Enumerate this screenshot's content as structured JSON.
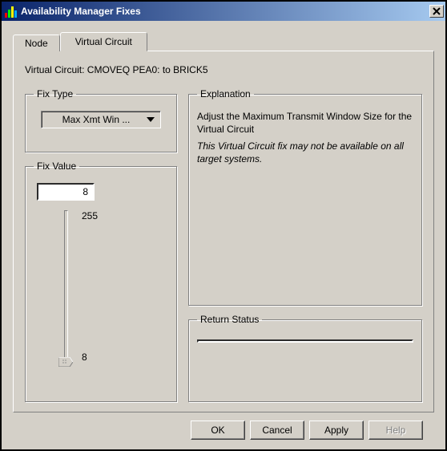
{
  "window": {
    "title": "Availability Manager Fixes"
  },
  "tabs": {
    "node": "Node",
    "virtual_circuit": "Virtual Circuit"
  },
  "vc_label": "Virtual Circuit: CMOVEQ PEA0: to BRICK5",
  "fix_type": {
    "legend": "Fix Type",
    "selected": "Max Xmt Win ..."
  },
  "fix_value": {
    "legend": "Fix Value",
    "value": "8",
    "max": "255",
    "min": "8"
  },
  "explanation": {
    "legend": "Explanation",
    "line1": "Adjust the Maximum Transmit Window Size for the Virtual Circuit",
    "line2": "This Virtual Circuit fix may not be available on all target systems."
  },
  "return_status": {
    "legend": "Return Status",
    "value": ""
  },
  "buttons": {
    "ok": "OK",
    "cancel": "Cancel",
    "apply": "Apply",
    "help": "Help"
  }
}
